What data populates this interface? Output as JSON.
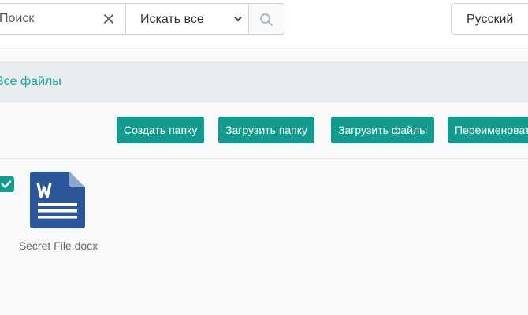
{
  "search": {
    "placeholder": "Поиск",
    "scope_selected": "Искать все"
  },
  "language": "Русский",
  "breadcrumb": {
    "root_label": "Все файлы"
  },
  "toolbar": {
    "create_folder": "Создать папку",
    "upload_folder": "Загрузить папку",
    "upload_files": "Загрузить файлы",
    "rename": "Переименовать"
  },
  "files": [
    {
      "name": "Secret File.docx",
      "type_icon": "word-doc-icon",
      "selected": true
    }
  ],
  "colors": {
    "accent": "#139c8e",
    "link": "#1aa39a",
    "word_blue": "#2b579a"
  }
}
